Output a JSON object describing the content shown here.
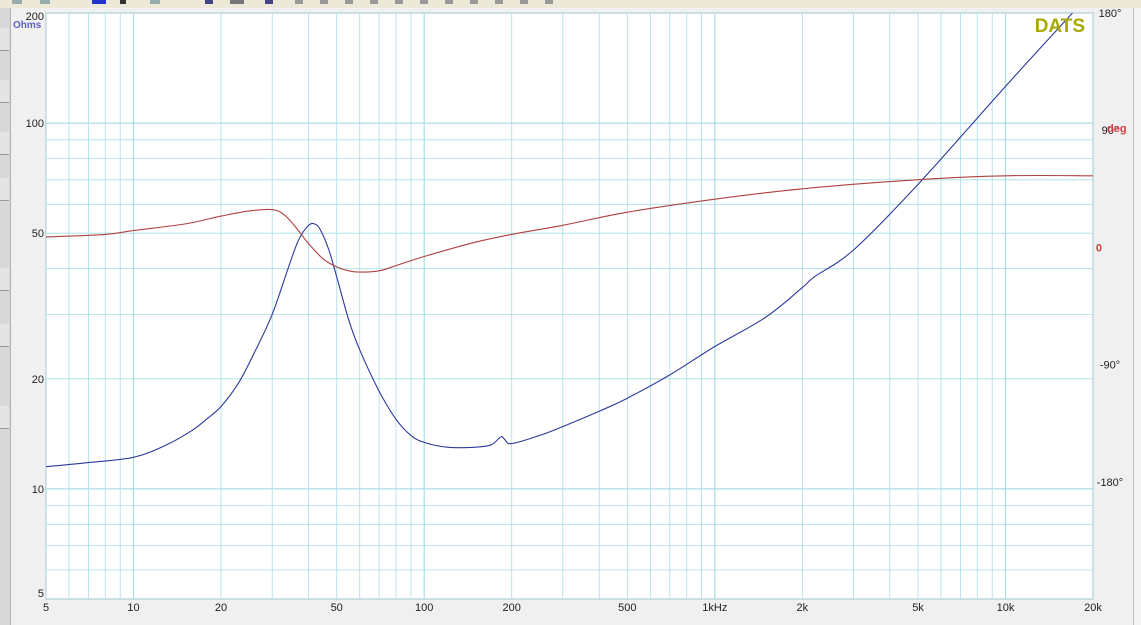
{
  "app": {
    "watermark": "DATS"
  },
  "colors": {
    "plot_bg": "#ffffff",
    "grid": "#a8dde6",
    "impedance": "#2b3a9c",
    "phase": "#b04040",
    "watermark": "#a8a800",
    "left_axis_label": "#6060c8",
    "phase_label": "#d04040"
  },
  "chart_data": {
    "type": "line",
    "title": "",
    "xscale": "log",
    "yscale": "log",
    "xlim": [
      5,
      20000
    ],
    "ylim": [
      5,
      200
    ],
    "ylabel": "Ohms",
    "y2label": "deg",
    "y2lim": [
      -270,
      180
    ],
    "grid": true,
    "x_tick_labels": [
      "5",
      "10",
      "20",
      "50",
      "100",
      "200",
      "500",
      "1kHz",
      "2k",
      "5k",
      "10k",
      "20k"
    ],
    "x_tick_values": [
      5,
      10,
      20,
      50,
      100,
      200,
      500,
      1000,
      2000,
      5000,
      10000,
      20000
    ],
    "y_tick_labels": [
      "5",
      "10",
      "20",
      "50",
      "100",
      "200"
    ],
    "y_tick_values": [
      5,
      10,
      20,
      50,
      100,
      200
    ],
    "y2_tick_labels": [
      "180°",
      "90°",
      "0",
      "-90°",
      "-180°"
    ],
    "y2_tick_values": [
      180,
      90,
      0,
      -90,
      -180
    ],
    "series": [
      {
        "key": "impedance",
        "axis": "left",
        "x": [
          5,
          7,
          10,
          13,
          16,
          18,
          20,
          23,
          26,
          30,
          34,
          37,
          40,
          42,
          44,
          47,
          50,
          55,
          60,
          70,
          80,
          90,
          100,
          120,
          150,
          170,
          180,
          185,
          190,
          200,
          250,
          300,
          400,
          500,
          700,
          1000,
          1500,
          2000,
          2200,
          3000,
          5000,
          10000,
          17000
        ],
        "y": [
          11.5,
          11.8,
          12.2,
          13.2,
          14.5,
          15.6,
          16.8,
          19.5,
          23.5,
          30,
          40,
          48,
          52.5,
          53,
          51,
          45,
          38,
          29,
          24,
          18.5,
          15.5,
          14,
          13.4,
          13,
          13,
          13.2,
          13.7,
          13.9,
          13.6,
          13.3,
          14,
          14.8,
          16.3,
          17.7,
          20.5,
          24.5,
          29.5,
          35.5,
          38,
          45,
          68,
          126,
          200
        ]
      },
      {
        "key": "phase",
        "axis": "right",
        "x": [
          5,
          8,
          10,
          15,
          20,
          25,
          30,
          33,
          36,
          40,
          45,
          50,
          55,
          60,
          70,
          80,
          100,
          150,
          200,
          300,
          500,
          1000,
          2000,
          5000,
          10000,
          20000
        ],
        "y": [
          8,
          10,
          13,
          18,
          24,
          28,
          29,
          25,
          16,
          3,
          -9,
          -15,
          -18,
          -19,
          -18,
          -14,
          -7,
          4,
          10,
          17,
          27,
          37,
          45,
          52,
          55,
          55
        ]
      }
    ]
  }
}
